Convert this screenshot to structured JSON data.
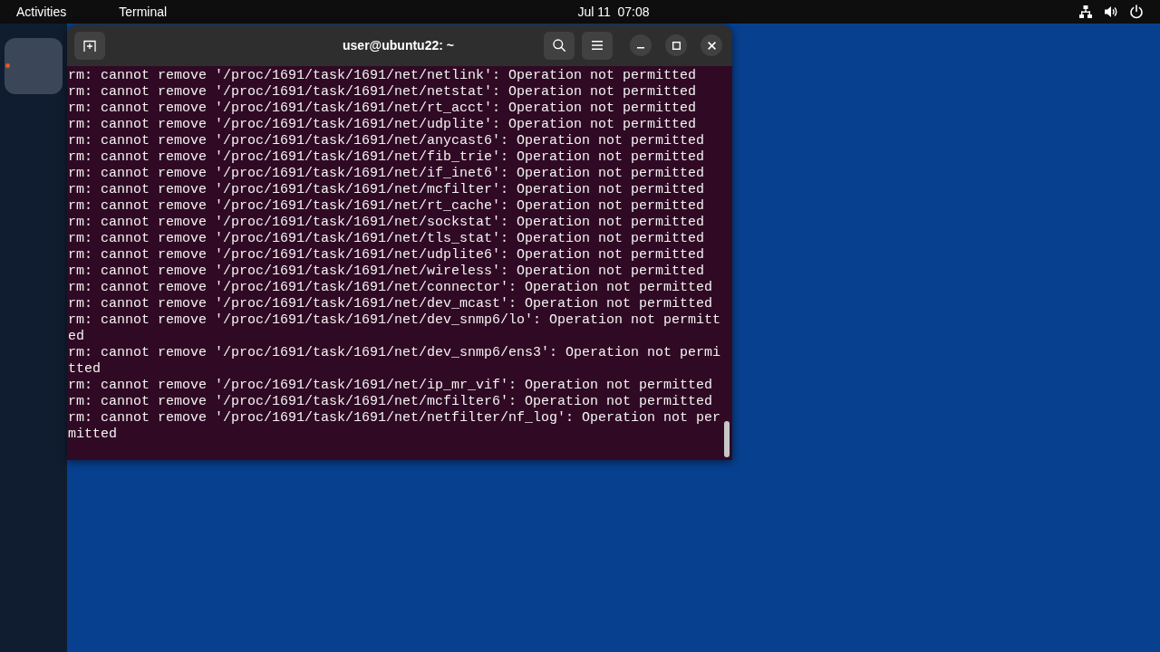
{
  "top_bar": {
    "activities": "Activities",
    "app_menu": "Terminal",
    "clock": "Jul 11  07:08"
  },
  "dock": {
    "apps": [
      {
        "running": true
      }
    ]
  },
  "terminal": {
    "title": "user@ubuntu22: ~",
    "lines": [
      "rm: cannot remove '/proc/1691/task/1691/net/netlink': Operation not permitted",
      "rm: cannot remove '/proc/1691/task/1691/net/netstat': Operation not permitted",
      "rm: cannot remove '/proc/1691/task/1691/net/rt_acct': Operation not permitted",
      "rm: cannot remove '/proc/1691/task/1691/net/udplite': Operation not permitted",
      "rm: cannot remove '/proc/1691/task/1691/net/anycast6': Operation not permitted",
      "rm: cannot remove '/proc/1691/task/1691/net/fib_trie': Operation not permitted",
      "rm: cannot remove '/proc/1691/task/1691/net/if_inet6': Operation not permitted",
      "rm: cannot remove '/proc/1691/task/1691/net/mcfilter': Operation not permitted",
      "rm: cannot remove '/proc/1691/task/1691/net/rt_cache': Operation not permitted",
      "rm: cannot remove '/proc/1691/task/1691/net/sockstat': Operation not permitted",
      "rm: cannot remove '/proc/1691/task/1691/net/tls_stat': Operation not permitted",
      "rm: cannot remove '/proc/1691/task/1691/net/udplite6': Operation not permitted",
      "rm: cannot remove '/proc/1691/task/1691/net/wireless': Operation not permitted",
      "rm: cannot remove '/proc/1691/task/1691/net/connector': Operation not permitted",
      "rm: cannot remove '/proc/1691/task/1691/net/dev_mcast': Operation not permitted",
      "rm: cannot remove '/proc/1691/task/1691/net/dev_snmp6/lo': Operation not permitted",
      "rm: cannot remove '/proc/1691/task/1691/net/dev_snmp6/ens3': Operation not permitted",
      "rm: cannot remove '/proc/1691/task/1691/net/ip_mr_vif': Operation not permitted",
      "rm: cannot remove '/proc/1691/task/1691/net/mcfilter6': Operation not permitted",
      "rm: cannot remove '/proc/1691/task/1691/net/netfilter/nf_log': Operation not permitted"
    ]
  }
}
